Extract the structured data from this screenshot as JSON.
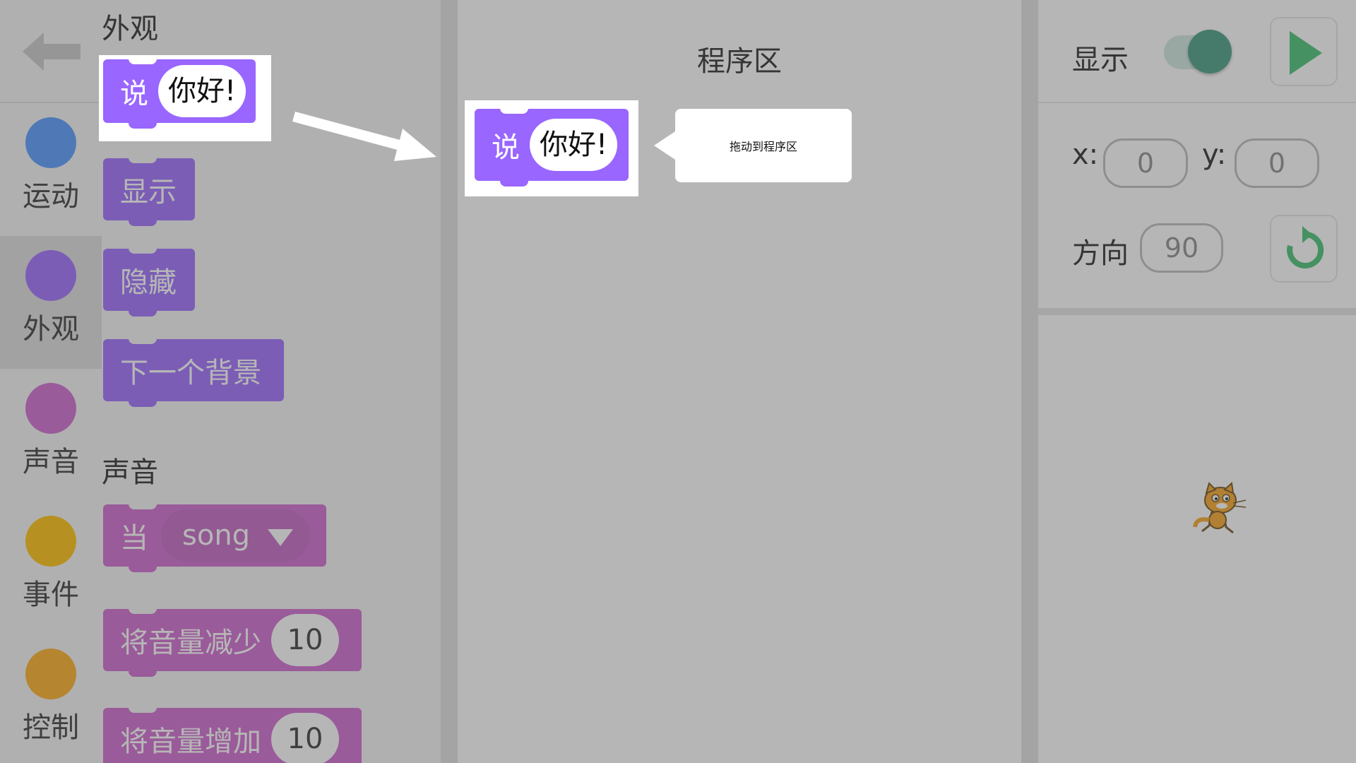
{
  "categories": [
    {
      "label": "运动",
      "color": "#4c97ff"
    },
    {
      "label": "外观",
      "color": "#9966ff",
      "selected": true
    },
    {
      "label": "声音",
      "color": "#cf63cf"
    },
    {
      "label": "事件",
      "color": "#ffbf00"
    },
    {
      "label": "控制",
      "color": "#ffab19"
    }
  ],
  "palette": {
    "looks_title": "外观",
    "say_block": {
      "verb": "说",
      "text": "你好!"
    },
    "show_block": "显示",
    "hide_block": "隐藏",
    "next_backdrop_block": "下一个背景",
    "sound_title": "声音",
    "when_block": {
      "verb": "当",
      "value": "song"
    },
    "volume_down_block": {
      "text": "将音量减少",
      "value": "10"
    },
    "volume_up_block": {
      "text": "将音量增加",
      "value": "10"
    }
  },
  "program": {
    "title": "程序区",
    "say_block": {
      "verb": "说",
      "text": "你好!"
    }
  },
  "tooltip": {
    "text": "拖动到程序区"
  },
  "sprite_panel": {
    "show_label": "显示",
    "show_toggle_on": true,
    "x_label": "x:",
    "x_value": "0",
    "y_label": "y:",
    "y_value": "0",
    "direction_label": "方向",
    "direction_value": "90"
  },
  "icons": {
    "back": "back-arrow-icon",
    "go": "green-flag-icon",
    "reset": "refresh-icon",
    "sprite": "scratch-cat-icon"
  }
}
